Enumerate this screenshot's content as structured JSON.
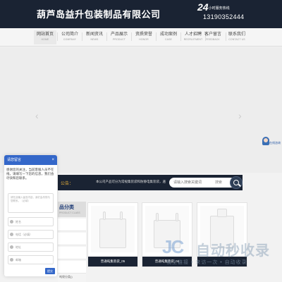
{
  "header": {
    "company_name": "葫芦岛益升包装制品有限公司",
    "hotline_24": "24",
    "hotline_label": "小时服务热线",
    "hotline_number": "13190352444"
  },
  "nav": [
    {
      "cn": "网站首页",
      "en": "HOME"
    },
    {
      "cn": "公司简介",
      "en": "COMPANY"
    },
    {
      "cn": "新闻资讯",
      "en": "NEWS"
    },
    {
      "cn": "产品展示",
      "en": "PRODUCT"
    },
    {
      "cn": "资质荣誉",
      "en": "HONOR"
    },
    {
      "cn": "成功案例",
      "en": "CASE"
    },
    {
      "cn": "人才招聘",
      "en": "RECRUITMENT"
    },
    {
      "cn": "客户留言",
      "en": "FEEDBACK"
    },
    {
      "cn": "联系我们",
      "en": "CONTACT US"
    }
  ],
  "banner": {
    "prev_arrow": "‹",
    "next_arrow": "›"
  },
  "service": {
    "label": "在线咨询"
  },
  "notice": {
    "label": "公告：",
    "text": "本公司产品可分为常规集装袋和防静电集装袋，遍",
    "search_placeholder": "请输入搜索关键词",
    "search_button": "搜索"
  },
  "category": {
    "title": "品分类",
    "subtitle": "PRODUCT CLASS",
    "footer_item": "吨袋分类()"
  },
  "products": [
    {
      "caption": "普通吨集装袋_05"
    },
    {
      "caption": "普通吨集装袋_04"
    },
    {
      "caption": ""
    }
  ],
  "message": {
    "title": "请您留言",
    "close": "×",
    "intro": "感谢您的关注，当前客服人员不在线，请填写一下您的信息，我们会尽快和您联系。",
    "textarea_placeholder": "请在此输入留言内容，我们会尽快与您联系。（必填）",
    "name_placeholder": "姓名",
    "phone_placeholder": "电话（必填）",
    "address_placeholder": "地址",
    "email_placeholder": "邮箱",
    "submit": "提交"
  },
  "watermark": {
    "logo": "JC",
    "text": "自动秒收录",
    "slogan": "我上链接 • 来访一次 • 自动收录"
  }
}
